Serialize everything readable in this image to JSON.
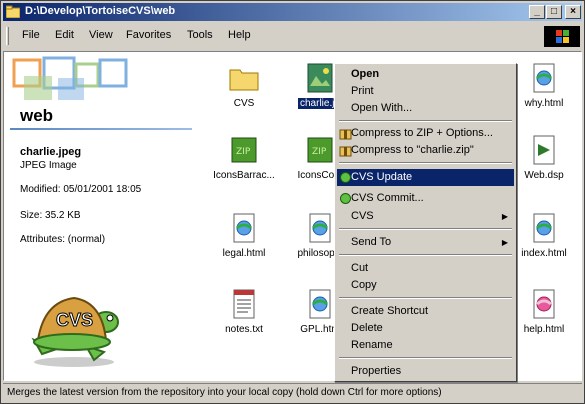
{
  "window": {
    "title": "D:\\Develop\\TortoiseCVS\\web",
    "controls": {
      "minimize": "_",
      "maximize": "□",
      "close": "×"
    }
  },
  "menubar": {
    "items": [
      "File",
      "Edit",
      "View",
      "Favorites",
      "Tools",
      "Help"
    ]
  },
  "left_pane": {
    "folder_name": "web",
    "selected_file": {
      "name": "charlie.jpeg",
      "type": "JPEG Image",
      "modified": "Modified: 05/01/2001 18:05",
      "size": "Size: 35.2 KB",
      "attributes": "Attributes: (normal)"
    },
    "mascot_text": "CVS"
  },
  "files": [
    {
      "label": "CVS",
      "icon": "folder-icon"
    },
    {
      "label": "charlie.jp",
      "icon": "jpeg-image-icon",
      "selected": true
    },
    {
      "label": "why.html",
      "icon": "html-icon"
    },
    {
      "label": "IconsBarrac...",
      "icon": "zip-icon"
    },
    {
      "label": "IconsCosr",
      "icon": "zip-icon"
    },
    {
      "label": "Web.dsp",
      "icon": "dsp-icon"
    },
    {
      "label": "legal.html",
      "icon": "html-icon"
    },
    {
      "label": "philosophi",
      "icon": "html-icon"
    },
    {
      "label": "index.html",
      "icon": "html-icon"
    },
    {
      "label": "notes.txt",
      "icon": "text-file-icon"
    },
    {
      "label": "GPL.htm",
      "icon": "html-icon"
    },
    {
      "label": "help.html",
      "icon": "html-icon"
    }
  ],
  "context_menu": {
    "open": "Open",
    "print": "Print",
    "open_with": "Open With...",
    "compress_options": "Compress to ZIP + Options...",
    "compress_zip": "Compress to \"charlie.zip\"",
    "cvs_update": "CVS Update",
    "cvs_commit": "CVS Commit...",
    "cvs": "CVS",
    "send_to": "Send To",
    "cut": "Cut",
    "copy": "Copy",
    "create_shortcut": "Create Shortcut",
    "delete": "Delete",
    "rename": "Rename",
    "properties": "Properties"
  },
  "statusbar": {
    "text": "Merges the latest version from the repository into your local copy (hold down Ctrl for more options)"
  },
  "colors": {
    "highlight": "#0a246a",
    "face": "#d4d0c8",
    "title_start": "#0a246a",
    "title_end": "#a6caf0"
  }
}
